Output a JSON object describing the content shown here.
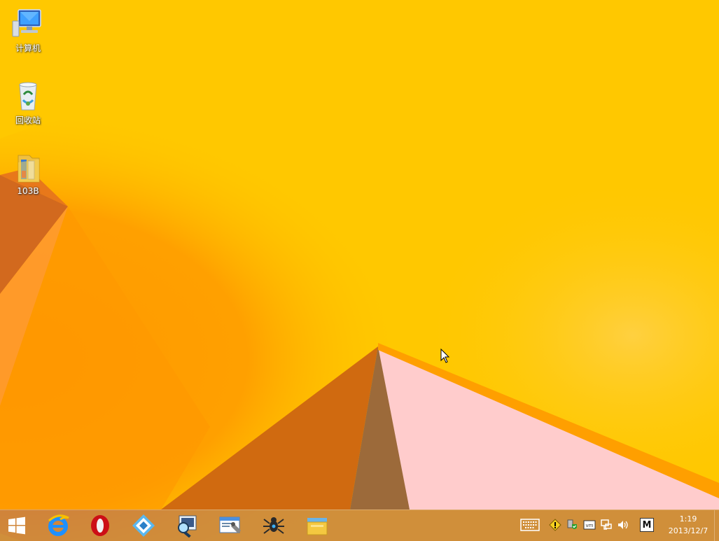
{
  "desktop": {
    "icons": [
      {
        "label": "计算机",
        "icon": "computer-icon"
      },
      {
        "label": "回收站",
        "icon": "recycle-bin-icon"
      },
      {
        "label": "103B",
        "icon": "folder-icon"
      }
    ]
  },
  "taskbar": {
    "start": {
      "icon": "windows-logo-icon"
    },
    "pinned": [
      {
        "icon": "internet-explorer-icon"
      },
      {
        "icon": "opera-icon"
      },
      {
        "icon": "diamond-app-icon"
      },
      {
        "icon": "screen-magnifier-icon"
      },
      {
        "icon": "window-tools-icon"
      },
      {
        "icon": "bug-spider-icon"
      },
      {
        "icon": "file-explorer-icon"
      }
    ],
    "tray": {
      "icons": [
        "touch-keyboard-icon",
        "warning-shield-icon",
        "security-shield-icon",
        "vmware-icon",
        "network-icon",
        "volume-icon"
      ],
      "ime_label": "M"
    },
    "clock": {
      "time": "1:19",
      "date": "2013/12/7"
    }
  },
  "colors": {
    "wallpaper_base": "#ffc800",
    "wallpaper_orange": "#ff9800",
    "wallpaper_dark_orange": "#d2691e",
    "wallpaper_pink": "#ffcccc",
    "taskbar": "#be7850"
  }
}
